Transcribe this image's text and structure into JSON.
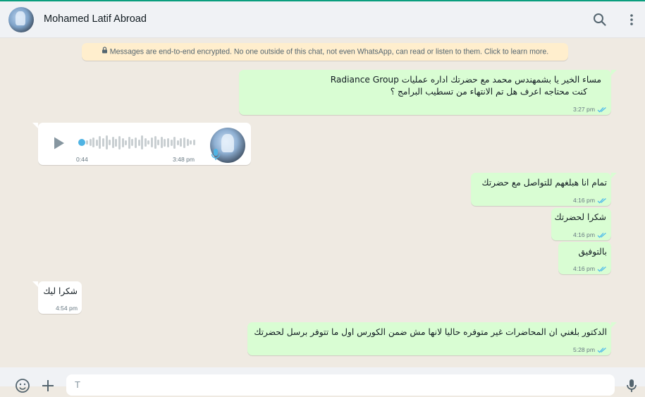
{
  "header": {
    "contact_name": "Mohamed Latif Abroad",
    "icons": [
      "search-icon",
      "menu-dots-icon"
    ]
  },
  "chat": {
    "encryption_notice": "Messages are end-to-end encrypted. No one outside of this chat, not even WhatsApp, can read or listen to them. Click to learn more.",
    "messages": [
      {
        "direction": "outgoing",
        "lines": [
          "مساء الخير يا بشمهندس محمد مع حضرتك اداره عمليات Radiance Group",
          "كنت محتاجه اعرف هل تم الانتهاء من تسطيب البرامج ؟"
        ],
        "time": "3:27 pm",
        "status": "read"
      },
      {
        "direction": "incoming",
        "type": "voice",
        "duration": "0:44",
        "time": "3:48 pm"
      },
      {
        "direction": "outgoing",
        "lines": [
          "تمام انا هبلغهم للتواصل مع حضرتك"
        ],
        "time": "4:16 pm",
        "status": "read"
      },
      {
        "direction": "outgoing",
        "lines": [
          "شكرا لحضرتك"
        ],
        "time": "4:16 pm",
        "status": "read"
      },
      {
        "direction": "outgoing",
        "lines": [
          "بالتوفيق"
        ],
        "time": "4:16 pm",
        "status": "read"
      },
      {
        "direction": "incoming",
        "lines": [
          "شكرا ليك"
        ],
        "time": "4:54 pm"
      },
      {
        "direction": "outgoing",
        "lines": [
          "الدكتور بلغني ان المحاضرات غير متوفره حاليا لانها مش ضمن الكورس اول ما تتوفر برسل لحضرتك"
        ],
        "time": "5:28 pm",
        "status": "read"
      }
    ]
  },
  "footer": {
    "compose_placeholder": "T",
    "icons": [
      "emoji-icon",
      "attach-plus-icon",
      "mic-icon"
    ]
  },
  "colors": {
    "accent": "#0a9e7e",
    "outgoing_bubble": "#d9fdd3",
    "incoming_bubble": "#ffffff",
    "read_ticks": "#53bdeb",
    "notice_bg": "#ffeecd"
  }
}
